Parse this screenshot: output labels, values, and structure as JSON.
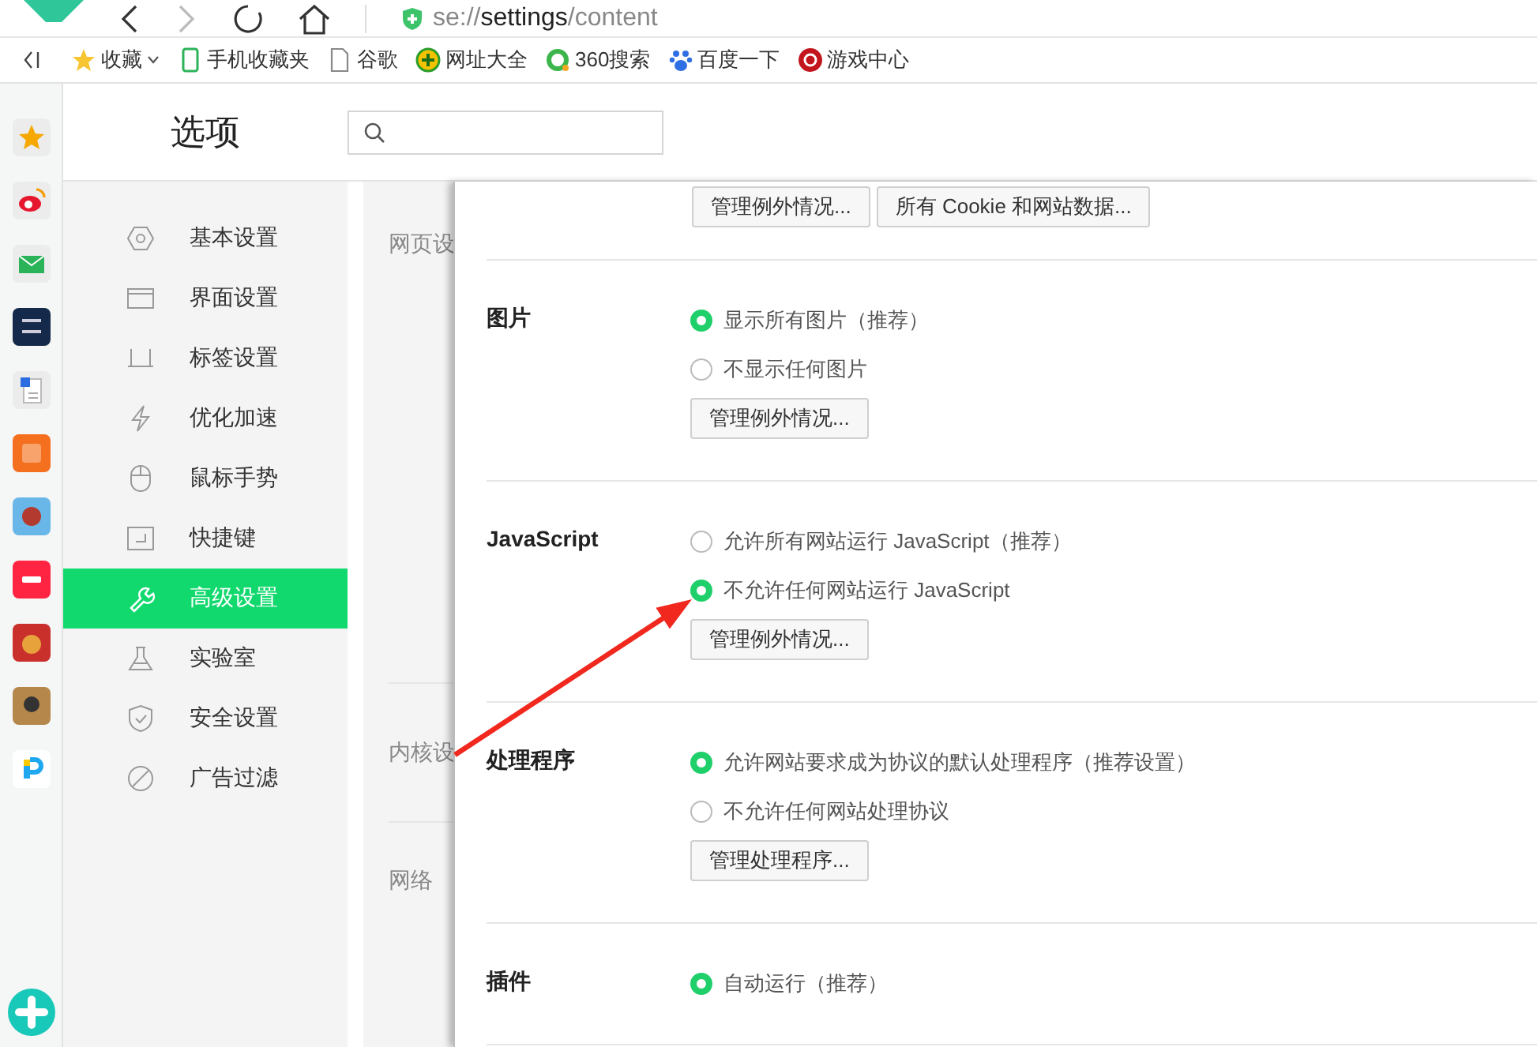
{
  "toolbar": {
    "address": "se://**settings**/content"
  },
  "bookmarks": [
    {
      "label": "收藏",
      "dropdown": true
    },
    {
      "label": "手机收藏夹",
      "dropdown": false
    },
    {
      "label": "谷歌",
      "dropdown": false
    },
    {
      "label": "网址大全",
      "dropdown": false
    },
    {
      "label": "360搜索",
      "dropdown": false
    },
    {
      "label": "百度一下",
      "dropdown": false
    },
    {
      "label": "游戏中心",
      "dropdown": false
    }
  ],
  "header": {
    "title": "选项"
  },
  "sidebar": {
    "items": [
      {
        "label": "基本设置",
        "selected": false
      },
      {
        "label": "界面设置",
        "selected": false
      },
      {
        "label": "标签设置",
        "selected": false
      },
      {
        "label": "优化加速",
        "selected": false
      },
      {
        "label": "鼠标手势",
        "selected": false
      },
      {
        "label": "快捷键",
        "selected": false
      },
      {
        "label": "高级设置",
        "selected": true
      },
      {
        "label": "实验室",
        "selected": false
      },
      {
        "label": "安全设置",
        "selected": false
      },
      {
        "label": "广告过滤",
        "selected": false
      }
    ]
  },
  "page_sections": [
    "网页设",
    "内核设",
    "网络"
  ],
  "dialog": {
    "sections": [
      {
        "buttons": [
          "管理例外情况...",
          "所有 Cookie 和网站数据..."
        ]
      },
      {
        "title": "图片",
        "options": [
          {
            "label": "显示所有图片（推荐）",
            "selected": true
          },
          {
            "label": "不显示任何图片",
            "selected": false
          }
        ],
        "buttons": [
          "管理例外情况..."
        ]
      },
      {
        "title": "JavaScript",
        "options": [
          {
            "label": "允许所有网站运行 JavaScript（推荐）",
            "selected": false
          },
          {
            "label": "不允许任何网站运行 JavaScript",
            "selected": true
          }
        ],
        "buttons": [
          "管理例外情况..."
        ]
      },
      {
        "title": "处理程序",
        "options": [
          {
            "label": "允许网站要求成为协议的默认处理程序（推荐设置）",
            "selected": true
          },
          {
            "label": "不允许任何网站处理协议",
            "selected": false
          }
        ],
        "buttons": [
          "管理处理程序..."
        ]
      },
      {
        "title": "插件",
        "options": [
          {
            "label": "自动运行（推荐）",
            "selected": true
          }
        ]
      }
    ]
  }
}
